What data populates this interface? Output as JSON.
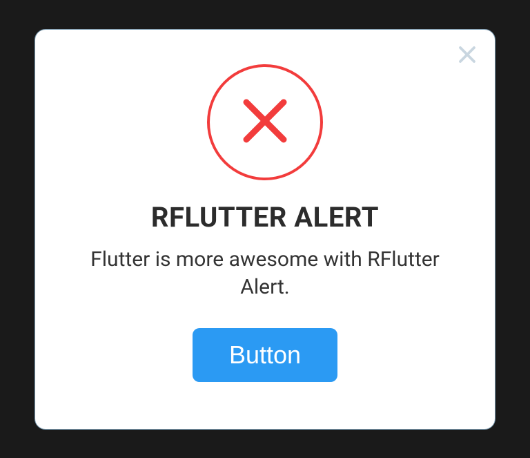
{
  "dialog": {
    "title": "RFLUTTER ALERT",
    "message": "Flutter is more awesome with RFlutter Alert.",
    "primary_button_label": "Button",
    "icon_type": "error",
    "colors": {
      "error": "#f23c3c",
      "primary": "#2b9af3",
      "close_icon": "#c9d6e0"
    }
  }
}
